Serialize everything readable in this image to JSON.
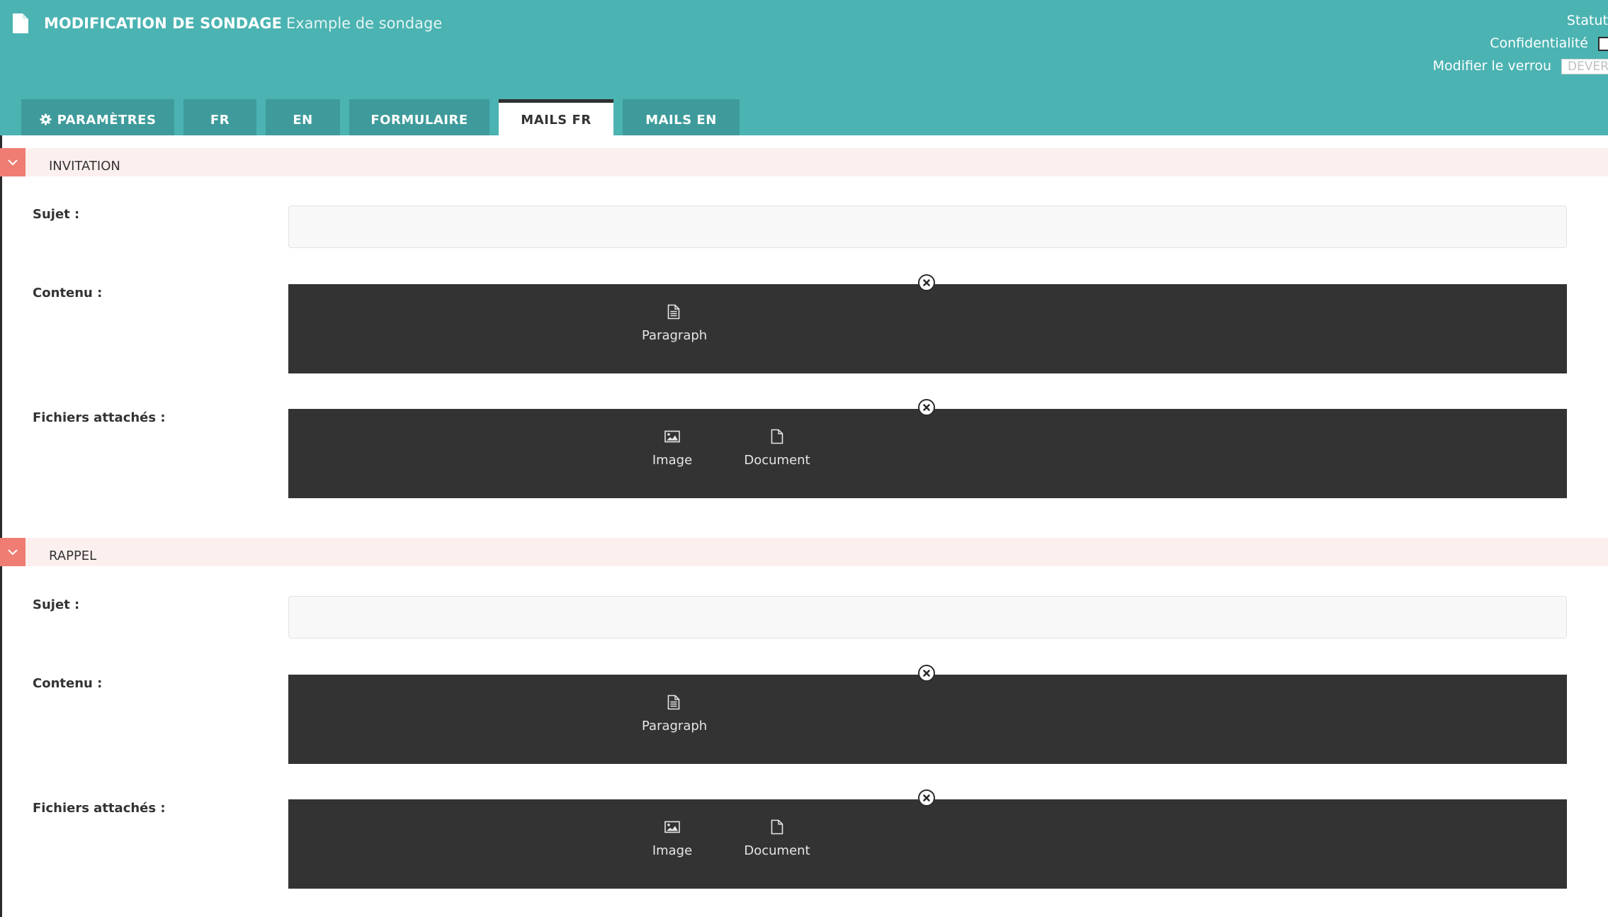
{
  "header": {
    "title": "MODIFICATION DE SONDAGE",
    "subtitle": "Example de sondage",
    "status_label": "Statut",
    "confidentiality_label": "Confidentialité",
    "lock_label": "Modifier le verrou",
    "lock_button": "DEVER",
    "colors": {
      "header_bg": "#4bb3b2",
      "tab_bg": "#3f9b9b",
      "accent": "#ef7d73"
    }
  },
  "tabs": [
    {
      "label": "PARAMÈTRES",
      "icon": "gear-icon"
    },
    {
      "label": "FR"
    },
    {
      "label": "EN"
    },
    {
      "label": "FORMULAIRE"
    },
    {
      "label": "MAILS FR",
      "active": true
    },
    {
      "label": "MAILS EN"
    }
  ],
  "sections": [
    {
      "title": "INVITATION",
      "subject_label": "Sujet :",
      "subject_value": "",
      "content_label": "Contenu :",
      "content_tools": [
        {
          "label": "Paragraph",
          "icon": "paragraph-icon"
        }
      ],
      "attachments_label": "Fichiers attachés :",
      "attachment_tools": [
        {
          "label": "Image",
          "icon": "image-icon"
        },
        {
          "label": "Document",
          "icon": "document-icon"
        }
      ]
    },
    {
      "title": "RAPPEL",
      "subject_label": "Sujet :",
      "subject_value": "",
      "content_label": "Contenu :",
      "content_tools": [
        {
          "label": "Paragraph",
          "icon": "paragraph-icon"
        }
      ],
      "attachments_label": "Fichiers attachés :",
      "attachment_tools": [
        {
          "label": "Image",
          "icon": "image-icon"
        },
        {
          "label": "Document",
          "icon": "document-icon"
        }
      ]
    }
  ]
}
